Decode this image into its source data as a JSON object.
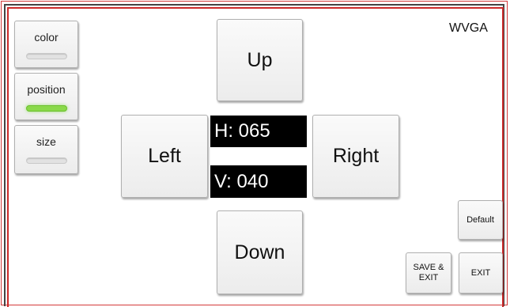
{
  "mode_label": "WVGA",
  "side_tabs": [
    {
      "label": "color",
      "active": false
    },
    {
      "label": "position",
      "active": true
    },
    {
      "label": "size",
      "active": false
    }
  ],
  "direction": {
    "up": "Up",
    "down": "Down",
    "left": "Left",
    "right": "Right"
  },
  "readout": {
    "h": "H: 065",
    "v": "V: 040"
  },
  "actions": {
    "default": "Default",
    "save_exit_line1": "SAVE &",
    "save_exit_line2": "EXIT",
    "exit": "EXIT"
  },
  "colors": {
    "frame_red": "#cc2a2a",
    "indicator_on": "#8ad94a",
    "readout_bg": "#000000"
  }
}
